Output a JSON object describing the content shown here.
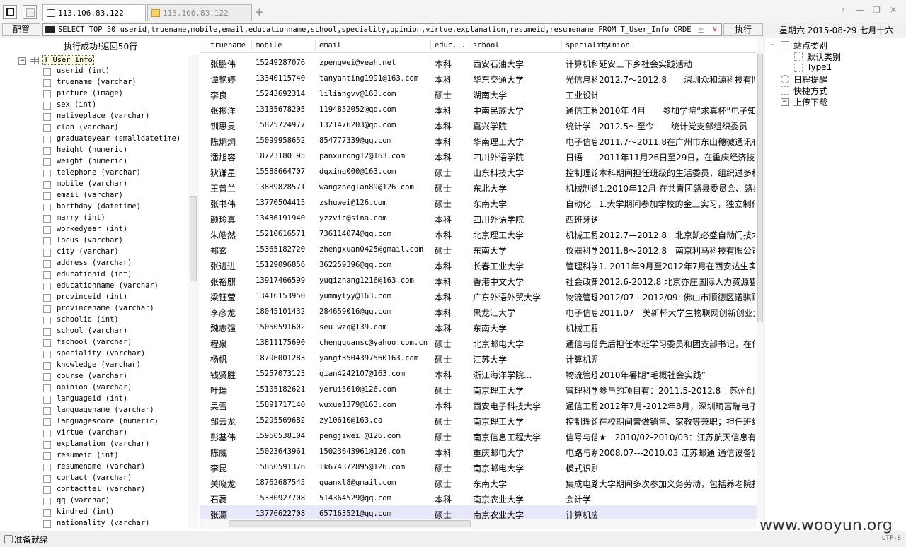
{
  "tabs": [
    {
      "title": "113.106.83.122",
      "icon": "database-icon"
    },
    {
      "title": "113.106.83.122",
      "icon": "folder-icon"
    }
  ],
  "toolbar": {
    "config_label": "配置",
    "sql_query": "SELECT TOP 50 userid,truename,mobile,email,educationname,school,speciality,opinion,virtue,explanation,resumeid,resumename FROM T_User_Info ORDER BY 1",
    "run_label": "执行",
    "date_text": "星期六 2015-08-29 七月十六"
  },
  "left_panel": {
    "status": "执行成功!返回50行",
    "table_name": "T_User_Info",
    "columns": [
      "userid (int)",
      "truename (varchar)",
      "picture (image)",
      "sex (int)",
      "nativeplace (varchar)",
      "clan (varchar)",
      "graduateyear (smalldatetime)",
      "height (numeric)",
      "weight (numeric)",
      "telephone (varchar)",
      "mobile (varchar)",
      "email (varchar)",
      "borthday (datetime)",
      "marry (int)",
      "workedyear (int)",
      "locus (varchar)",
      "city (varchar)",
      "address (varchar)",
      "educationid (int)",
      "educationname (varchar)",
      "provinceid (int)",
      "provincename (varchar)",
      "schoolid (int)",
      "school (varchar)",
      "fschool (varchar)",
      "speciality (varchar)",
      "knowledge (varchar)",
      "course (varchar)",
      "opinion (varchar)",
      "languageid (int)",
      "languagename (varchar)",
      "languagescore (numeric)",
      "virtue (varchar)",
      "explanation (varchar)",
      "resumeid (int)",
      "resumename (varchar)",
      "contact (varchar)",
      "contacttel (varchar)",
      "qq (varchar)",
      "kindred (int)",
      "nationality (varchar)"
    ]
  },
  "grid": {
    "headers": [
      "truename",
      "mobile",
      "email",
      "educ...",
      "school",
      "speciality",
      "opinion"
    ],
    "rows": [
      [
        "张鹏伟",
        "15249287076",
        "zpengwei@yeah.net",
        "本科",
        "西安石油大学",
        "计算机科...",
        "延安三下乡社会实践活动"
      ],
      [
        "谭艳婷",
        "13340115740",
        "tanyanting1991@163.com",
        "本科",
        "华东交通大学",
        "光信息科...",
        "2012.7～2012.8　　深圳众和源科技有限"
      ],
      [
        "李良",
        "15243692314",
        "liliangvv@163.com",
        "硕士",
        "湖南大学",
        "工业设计",
        ""
      ],
      [
        "张振洋",
        "13135678205",
        "1194852052@qq.com",
        "本科",
        "中南民族大学",
        "通信工程",
        "2010年 4月　　参加学院“求真杯”电子知"
      ],
      [
        "钏思旻",
        "15825724977",
        "1321476203@qq.com",
        "本科",
        "嘉兴学院",
        "统计学",
        "2012.5～至今　　统计党支部组织委员"
      ],
      [
        "陈炯炯",
        "15099958652",
        "854777339@qq.com",
        "本科",
        "华南理工大学",
        "电子信息工程",
        "2011.7～2011.8在广州市东山穗微通讯有限"
      ],
      [
        "潘旭容",
        "18723180195",
        "panxurong12@163.com",
        "本科",
        "四川外语学院",
        "日语",
        "2011年11月26日至29日，在重庆经济技术开"
      ],
      [
        "狄谦星",
        "15588664707",
        "dqxing000@163.com",
        "硕士",
        "山东科技大学",
        "控制理论...",
        "本科期间担任班级的生活委员，组织过多种"
      ],
      [
        "王曾兰",
        "13889828571",
        "wangzneglan89@126.com",
        "硕士",
        "东北大学",
        "机械制造...",
        "1.2010年12月 在共青团赣县委员会、赣县"
      ],
      [
        "张书伟",
        "13770504415",
        "zshuwei@126.com",
        "硕士",
        "东南大学",
        "自动化",
        "1.大学期间参加学校的金工实习，独立制作"
      ],
      [
        "颜珍真",
        "13436191940",
        "yzzvic@sina.com",
        "本科",
        "四川外语学院",
        "西班牙语",
        ""
      ],
      [
        "朱皓然",
        "15210616571",
        "736114074@qq.com",
        "本科",
        "北京理工大学",
        "机械工程...",
        "2012.7—2012.8　北京凯必盛自动门技术有"
      ],
      [
        "郑玄",
        "15365182720",
        "zhengxuan0425@gmail.com",
        "硕士",
        "东南大学",
        "仪器科学...",
        "2011.8～2012.8　南京利马科技有限公司"
      ],
      [
        "张进进",
        "15129096856",
        "362259396@qq.com",
        "本科",
        "长春工业大学",
        "管理科学...",
        "1. 2011年9月至2012年7月在西安达生实业"
      ],
      [
        "张裕麒",
        "13917466599",
        "yuqizhang1216@163.com",
        "本科",
        "香港中文大学",
        "社会政策",
        "2012.6-2012.8 北京亦庄国际人力资源猎头"
      ],
      [
        "梁钰莹",
        "13416153950",
        "yummylyy@163.com",
        "本科",
        "广东外语外贸大学",
        "物流管理",
        "2012/07 - 2012/09: 佛山市顺德区诺骐财"
      ],
      [
        "李彦龙",
        "18045101432",
        "284659016@qq.com",
        "本科",
        "黑龙江大学",
        "电子信息工程",
        "2011.07　美新杯大学生物联网创新创业大"
      ],
      [
        "魏志强",
        "15050591602",
        "seu_wzq@139.com",
        "本科",
        "东南大学",
        "机械工程...",
        ""
      ],
      [
        "程泉",
        "13811175690",
        "chengquansc@yahoo.com.cn",
        "硕士",
        "北京邮电大学",
        "通信与信...",
        "先后担任本班学习委员和团支部书记，在任"
      ],
      [
        "杨帆",
        "18796001283",
        "yangf3504397560163.com",
        "硕士",
        "江苏大学",
        "计算机系...",
        ""
      ],
      [
        "钱贤胜",
        "15257073123",
        "qian4242107@163.com",
        "本科",
        "浙江海洋学院...",
        "物流管理",
        "2010年暑期“毛概社会实践”"
      ],
      [
        "叶瑞",
        "15105182621",
        "yerui5610@126.com",
        "硕士",
        "南京理工大学",
        "管理科学...",
        "参与的项目有：2011.5-2012.8　苏州创新"
      ],
      [
        "吴雪",
        "15891717140",
        "wuxue1379@163.com",
        "本科",
        "西安电子科技大学",
        "通信工程",
        "2012年7月-2012年8月，深圳琦富瑞电子有"
      ],
      [
        "邹云龙",
        "15295569682",
        "zy10610@163.co",
        "硕士",
        "南京理工大学",
        "控制理论...",
        "在校期间曾做销售、家教等兼职；担任班级"
      ],
      [
        "彭基伟",
        "15950538104",
        "pengjiwei_@126.com",
        "硕士",
        "南京信息工程大学",
        "信号与信...",
        "★　2010/02-2010/03：江苏航天信息有限"
      ],
      [
        "陈威",
        "15023643961",
        "15023643961@126.com",
        "本科",
        "重庆邮电大学",
        "电路与系统",
        "2008.07---2010.03 江苏邮通 通信设备监"
      ],
      [
        "李昆",
        "15850591376",
        "lk674372895@126.com",
        "硕士",
        "南京邮电大学",
        "模式识别...",
        ""
      ],
      [
        "关晓龙",
        "18762687545",
        "guanxl8@gmail.com",
        "硕士",
        "东南大学",
        "集成电路工程",
        "大学期间多次参加义务劳动，包括养老院打"
      ],
      [
        "石磊",
        "15380927708",
        "514364529@qq.com",
        "本科",
        "南京农业大学",
        "会计学",
        ""
      ],
      [
        "张灏",
        "13776622708",
        "657163521@qq.com",
        "硕士",
        "南京农业大学",
        "计算机应...",
        ""
      ]
    ]
  },
  "right_panel": {
    "items": [
      {
        "label": "站点类别",
        "level": 0,
        "toggle": "−"
      },
      {
        "label": "默认类别",
        "level": 1
      },
      {
        "label": "Type1",
        "level": 1
      },
      {
        "label": "日程提醒",
        "level": 0,
        "icon": "clock-icon"
      },
      {
        "label": "快捷方式",
        "level": 0,
        "icon": "shortcut-icon"
      },
      {
        "label": "上传下载",
        "level": 0,
        "toggle": "−"
      }
    ]
  },
  "statusbar": {
    "text": "准备就绪",
    "watermark": "www.wooyun.org",
    "encoding": "UTF-8"
  }
}
